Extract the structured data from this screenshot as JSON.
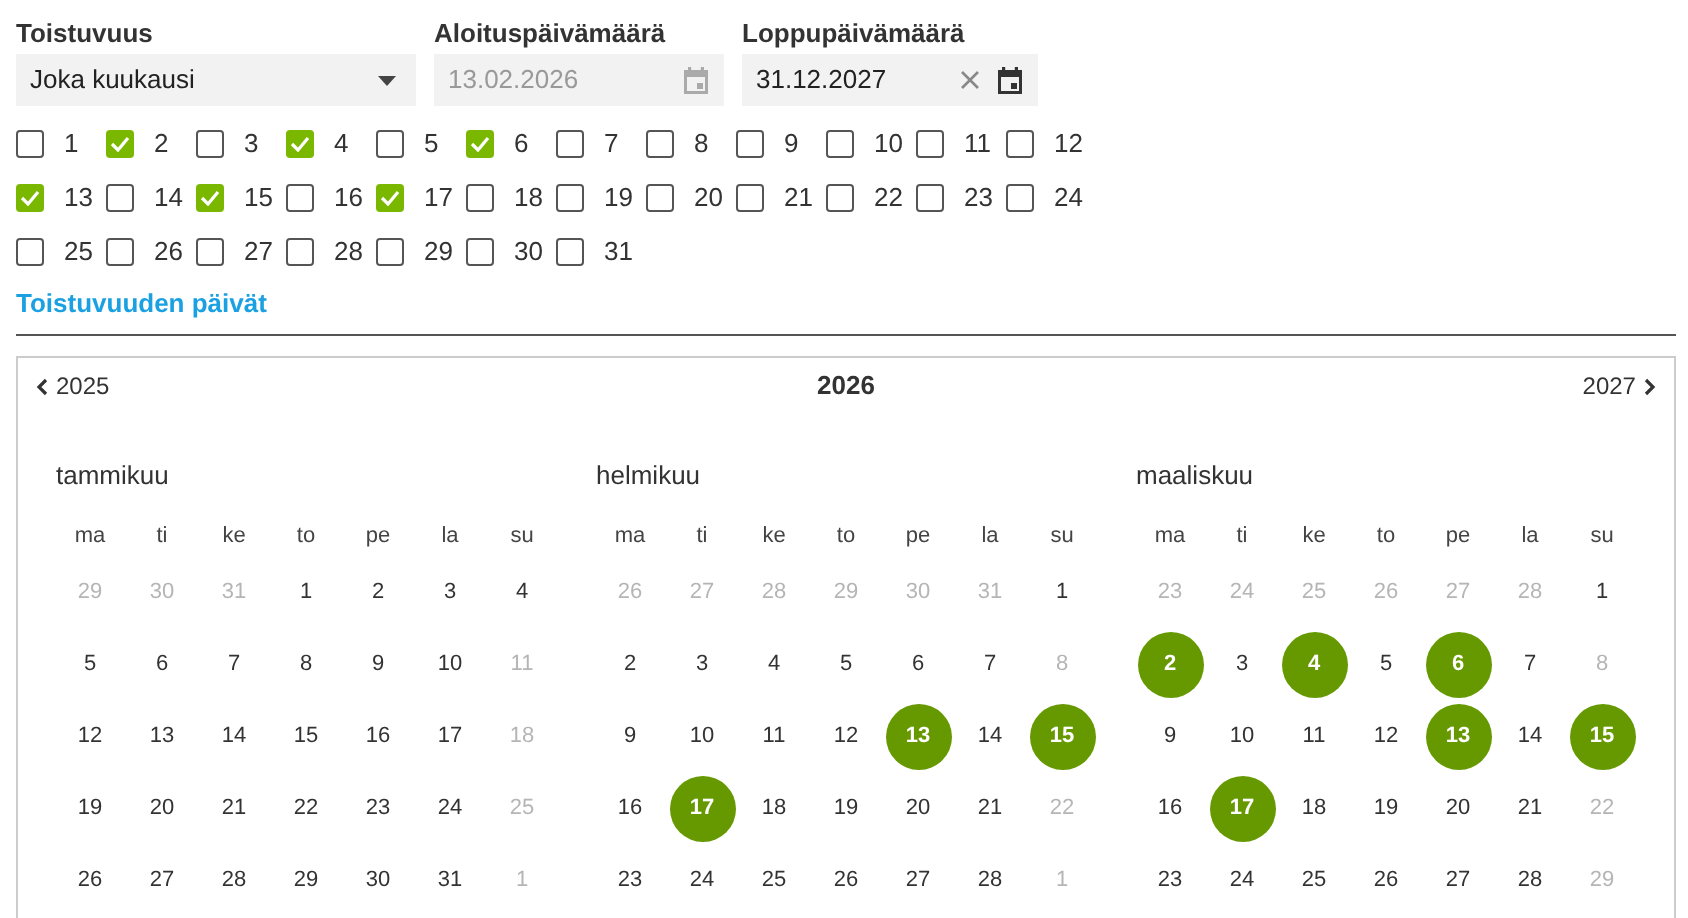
{
  "fields": [
    {
      "kind": "select",
      "label": "Toistuvuus",
      "value": "Joka kuukausi",
      "disabled": false,
      "clearable": false
    },
    {
      "kind": "date",
      "label": "Aloituspäivämäärä",
      "value": "13.02.2026",
      "disabled": true,
      "clearable": false
    },
    {
      "kind": "date",
      "label": "Loppupäivämäärä",
      "value": "31.12.2027",
      "disabled": false,
      "clearable": true
    }
  ],
  "days": [
    {
      "label": "1",
      "checked": false
    },
    {
      "label": "2",
      "checked": true
    },
    {
      "label": "3",
      "checked": false
    },
    {
      "label": "4",
      "checked": true
    },
    {
      "label": "5",
      "checked": false
    },
    {
      "label": "6",
      "checked": true
    },
    {
      "label": "7",
      "checked": false
    },
    {
      "label": "8",
      "checked": false
    },
    {
      "label": "9",
      "checked": false
    },
    {
      "label": "10",
      "checked": false
    },
    {
      "label": "11",
      "checked": false
    },
    {
      "label": "12",
      "checked": false
    },
    {
      "label": "13",
      "checked": true
    },
    {
      "label": "14",
      "checked": false
    },
    {
      "label": "15",
      "checked": true
    },
    {
      "label": "16",
      "checked": false
    },
    {
      "label": "17",
      "checked": true
    },
    {
      "label": "18",
      "checked": false
    },
    {
      "label": "19",
      "checked": false
    },
    {
      "label": "20",
      "checked": false
    },
    {
      "label": "21",
      "checked": false
    },
    {
      "label": "22",
      "checked": false
    },
    {
      "label": "23",
      "checked": false
    },
    {
      "label": "24",
      "checked": false
    },
    {
      "label": "25",
      "checked": false
    },
    {
      "label": "26",
      "checked": false
    },
    {
      "label": "27",
      "checked": false
    },
    {
      "label": "28",
      "checked": false
    },
    {
      "label": "29",
      "checked": false
    },
    {
      "label": "30",
      "checked": false
    },
    {
      "label": "31",
      "checked": false
    }
  ],
  "section_title": "Toistuvuuden päivät",
  "calendar": {
    "prev_year": "2025",
    "year": "2026",
    "next_year": "2027",
    "months": [
      {
        "name": "tammikuu",
        "weekdays": [
          "ma",
          "ti",
          "ke",
          "to",
          "pe",
          "la",
          "su"
        ],
        "weeks": [
          [
            {
              "day": "29",
              "muted": true,
              "selected": false
            },
            {
              "day": "30",
              "muted": true,
              "selected": false
            },
            {
              "day": "31",
              "muted": true,
              "selected": false
            },
            {
              "day": "1",
              "muted": false,
              "selected": false
            },
            {
              "day": "2",
              "muted": false,
              "selected": false
            },
            {
              "day": "3",
              "muted": false,
              "selected": false
            },
            {
              "day": "4",
              "muted": false,
              "selected": false
            }
          ],
          [
            {
              "day": "5",
              "muted": false,
              "selected": false
            },
            {
              "day": "6",
              "muted": false,
              "selected": false
            },
            {
              "day": "7",
              "muted": false,
              "selected": false
            },
            {
              "day": "8",
              "muted": false,
              "selected": false
            },
            {
              "day": "9",
              "muted": false,
              "selected": false
            },
            {
              "day": "10",
              "muted": false,
              "selected": false
            },
            {
              "day": "11",
              "muted": true,
              "selected": false
            }
          ],
          [
            {
              "day": "12",
              "muted": false,
              "selected": false
            },
            {
              "day": "13",
              "muted": false,
              "selected": false
            },
            {
              "day": "14",
              "muted": false,
              "selected": false
            },
            {
              "day": "15",
              "muted": false,
              "selected": false
            },
            {
              "day": "16",
              "muted": false,
              "selected": false
            },
            {
              "day": "17",
              "muted": false,
              "selected": false
            },
            {
              "day": "18",
              "muted": true,
              "selected": false
            }
          ],
          [
            {
              "day": "19",
              "muted": false,
              "selected": false
            },
            {
              "day": "20",
              "muted": false,
              "selected": false
            },
            {
              "day": "21",
              "muted": false,
              "selected": false
            },
            {
              "day": "22",
              "muted": false,
              "selected": false
            },
            {
              "day": "23",
              "muted": false,
              "selected": false
            },
            {
              "day": "24",
              "muted": false,
              "selected": false
            },
            {
              "day": "25",
              "muted": true,
              "selected": false
            }
          ],
          [
            {
              "day": "26",
              "muted": false,
              "selected": false
            },
            {
              "day": "27",
              "muted": false,
              "selected": false
            },
            {
              "day": "28",
              "muted": false,
              "selected": false
            },
            {
              "day": "29",
              "muted": false,
              "selected": false
            },
            {
              "day": "30",
              "muted": false,
              "selected": false
            },
            {
              "day": "31",
              "muted": false,
              "selected": false
            },
            {
              "day": "1",
              "muted": true,
              "selected": false
            }
          ]
        ]
      },
      {
        "name": "helmikuu",
        "weekdays": [
          "ma",
          "ti",
          "ke",
          "to",
          "pe",
          "la",
          "su"
        ],
        "weeks": [
          [
            {
              "day": "26",
              "muted": true,
              "selected": false
            },
            {
              "day": "27",
              "muted": true,
              "selected": false
            },
            {
              "day": "28",
              "muted": true,
              "selected": false
            },
            {
              "day": "29",
              "muted": true,
              "selected": false
            },
            {
              "day": "30",
              "muted": true,
              "selected": false
            },
            {
              "day": "31",
              "muted": true,
              "selected": false
            },
            {
              "day": "1",
              "muted": false,
              "selected": false
            }
          ],
          [
            {
              "day": "2",
              "muted": false,
              "selected": false
            },
            {
              "day": "3",
              "muted": false,
              "selected": false
            },
            {
              "day": "4",
              "muted": false,
              "selected": false
            },
            {
              "day": "5",
              "muted": false,
              "selected": false
            },
            {
              "day": "6",
              "muted": false,
              "selected": false
            },
            {
              "day": "7",
              "muted": false,
              "selected": false
            },
            {
              "day": "8",
              "muted": true,
              "selected": false
            }
          ],
          [
            {
              "day": "9",
              "muted": false,
              "selected": false
            },
            {
              "day": "10",
              "muted": false,
              "selected": false
            },
            {
              "day": "11",
              "muted": false,
              "selected": false
            },
            {
              "day": "12",
              "muted": false,
              "selected": false
            },
            {
              "day": "13",
              "muted": false,
              "selected": true
            },
            {
              "day": "14",
              "muted": false,
              "selected": false
            },
            {
              "day": "15",
              "muted": false,
              "selected": true
            }
          ],
          [
            {
              "day": "16",
              "muted": false,
              "selected": false
            },
            {
              "day": "17",
              "muted": false,
              "selected": true
            },
            {
              "day": "18",
              "muted": false,
              "selected": false
            },
            {
              "day": "19",
              "muted": false,
              "selected": false
            },
            {
              "day": "20",
              "muted": false,
              "selected": false
            },
            {
              "day": "21",
              "muted": false,
              "selected": false
            },
            {
              "day": "22",
              "muted": true,
              "selected": false
            }
          ],
          [
            {
              "day": "23",
              "muted": false,
              "selected": false
            },
            {
              "day": "24",
              "muted": false,
              "selected": false
            },
            {
              "day": "25",
              "muted": false,
              "selected": false
            },
            {
              "day": "26",
              "muted": false,
              "selected": false
            },
            {
              "day": "27",
              "muted": false,
              "selected": false
            },
            {
              "day": "28",
              "muted": false,
              "selected": false
            },
            {
              "day": "1",
              "muted": true,
              "selected": false
            }
          ]
        ]
      },
      {
        "name": "maaliskuu",
        "weekdays": [
          "ma",
          "ti",
          "ke",
          "to",
          "pe",
          "la",
          "su"
        ],
        "weeks": [
          [
            {
              "day": "23",
              "muted": true,
              "selected": false
            },
            {
              "day": "24",
              "muted": true,
              "selected": false
            },
            {
              "day": "25",
              "muted": true,
              "selected": false
            },
            {
              "day": "26",
              "muted": true,
              "selected": false
            },
            {
              "day": "27",
              "muted": true,
              "selected": false
            },
            {
              "day": "28",
              "muted": true,
              "selected": false
            },
            {
              "day": "1",
              "muted": false,
              "selected": false
            }
          ],
          [
            {
              "day": "2",
              "muted": false,
              "selected": true
            },
            {
              "day": "3",
              "muted": false,
              "selected": false
            },
            {
              "day": "4",
              "muted": false,
              "selected": true
            },
            {
              "day": "5",
              "muted": false,
              "selected": false
            },
            {
              "day": "6",
              "muted": false,
              "selected": true
            },
            {
              "day": "7",
              "muted": false,
              "selected": false
            },
            {
              "day": "8",
              "muted": true,
              "selected": false
            }
          ],
          [
            {
              "day": "9",
              "muted": false,
              "selected": false
            },
            {
              "day": "10",
              "muted": false,
              "selected": false
            },
            {
              "day": "11",
              "muted": false,
              "selected": false
            },
            {
              "day": "12",
              "muted": false,
              "selected": false
            },
            {
              "day": "13",
              "muted": false,
              "selected": true
            },
            {
              "day": "14",
              "muted": false,
              "selected": false
            },
            {
              "day": "15",
              "muted": false,
              "selected": true
            }
          ],
          [
            {
              "day": "16",
              "muted": false,
              "selected": false
            },
            {
              "day": "17",
              "muted": false,
              "selected": true
            },
            {
              "day": "18",
              "muted": false,
              "selected": false
            },
            {
              "day": "19",
              "muted": false,
              "selected": false
            },
            {
              "day": "20",
              "muted": false,
              "selected": false
            },
            {
              "day": "21",
              "muted": false,
              "selected": false
            },
            {
              "day": "22",
              "muted": true,
              "selected": false
            }
          ],
          [
            {
              "day": "23",
              "muted": false,
              "selected": false
            },
            {
              "day": "24",
              "muted": false,
              "selected": false
            },
            {
              "day": "25",
              "muted": false,
              "selected": false
            },
            {
              "day": "26",
              "muted": false,
              "selected": false
            },
            {
              "day": "27",
              "muted": false,
              "selected": false
            },
            {
              "day": "28",
              "muted": false,
              "selected": false
            },
            {
              "day": "29",
              "muted": true,
              "selected": false
            }
          ]
        ]
      }
    ]
  }
}
